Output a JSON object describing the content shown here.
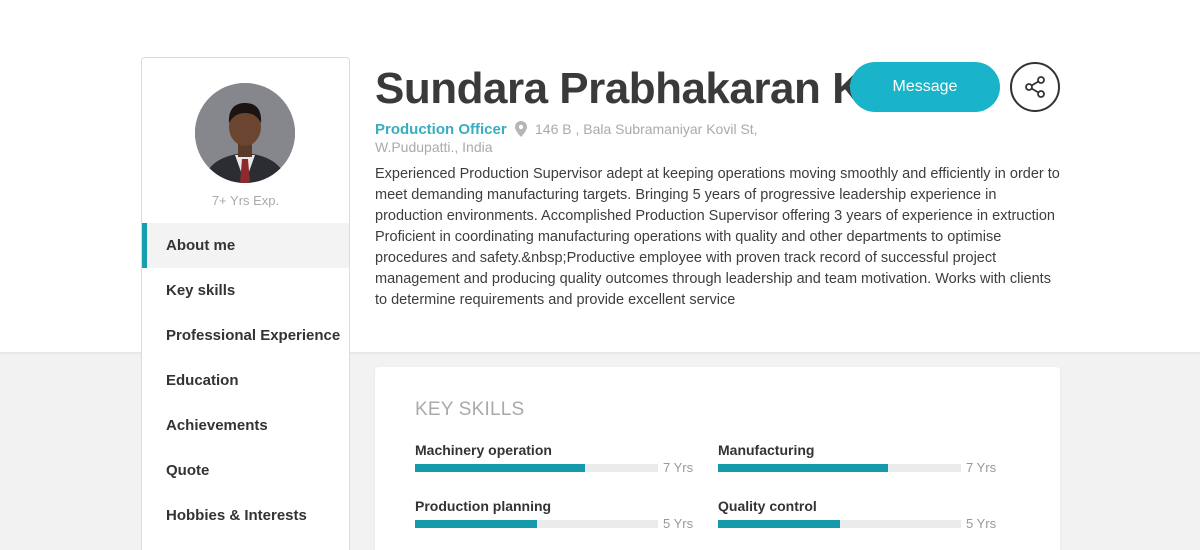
{
  "profile": {
    "name": "Sundara Prabhakaran K",
    "role": "Production Officer",
    "address_line1": "146 B , Bala Subramaniyar Kovil St,",
    "address_line2": "W.Pudupatti., India",
    "experience": "7+ Yrs Exp.",
    "about": "Experienced Production Supervisor adept at keeping operations moving smoothly and efficiently in order to meet demanding manufacturing targets. Bringing 5 years of progressive leadership experience in production environments. Accomplished Production Supervisor offering 3 years of experience in extruction Proficient in coordinating manufacturing operations with quality and other departments to optimise procedures and safety.&nbsp;Productive employee with proven track record of successful project management and producing quality outcomes through leadership and team motivation. Works with clients to determine requirements and provide excellent service"
  },
  "actions": {
    "message_label": "Message",
    "share_icon": "share-icon"
  },
  "sidebar": {
    "items": [
      {
        "label": "About me",
        "active": true
      },
      {
        "label": "Key skills",
        "active": false
      },
      {
        "label": "Professional Experience",
        "active": false
      },
      {
        "label": "Education",
        "active": false
      },
      {
        "label": "Achievements",
        "active": false
      },
      {
        "label": "Quote",
        "active": false
      },
      {
        "label": "Hobbies & Interests",
        "active": false
      }
    ]
  },
  "skills": {
    "title": "KEY SKILLS",
    "items": [
      {
        "name": "Machinery operation",
        "years": "7 Yrs",
        "level": 0.7
      },
      {
        "name": "Manufacturing",
        "years": "7 Yrs",
        "level": 0.7
      },
      {
        "name": "Production planning",
        "years": "5 Yrs",
        "level": 0.5
      },
      {
        "name": "Quality control",
        "years": "5 Yrs",
        "level": 0.5
      }
    ]
  },
  "colors": {
    "accent": "#19b3ca",
    "bar": "#159aac",
    "role": "#37aebe"
  }
}
